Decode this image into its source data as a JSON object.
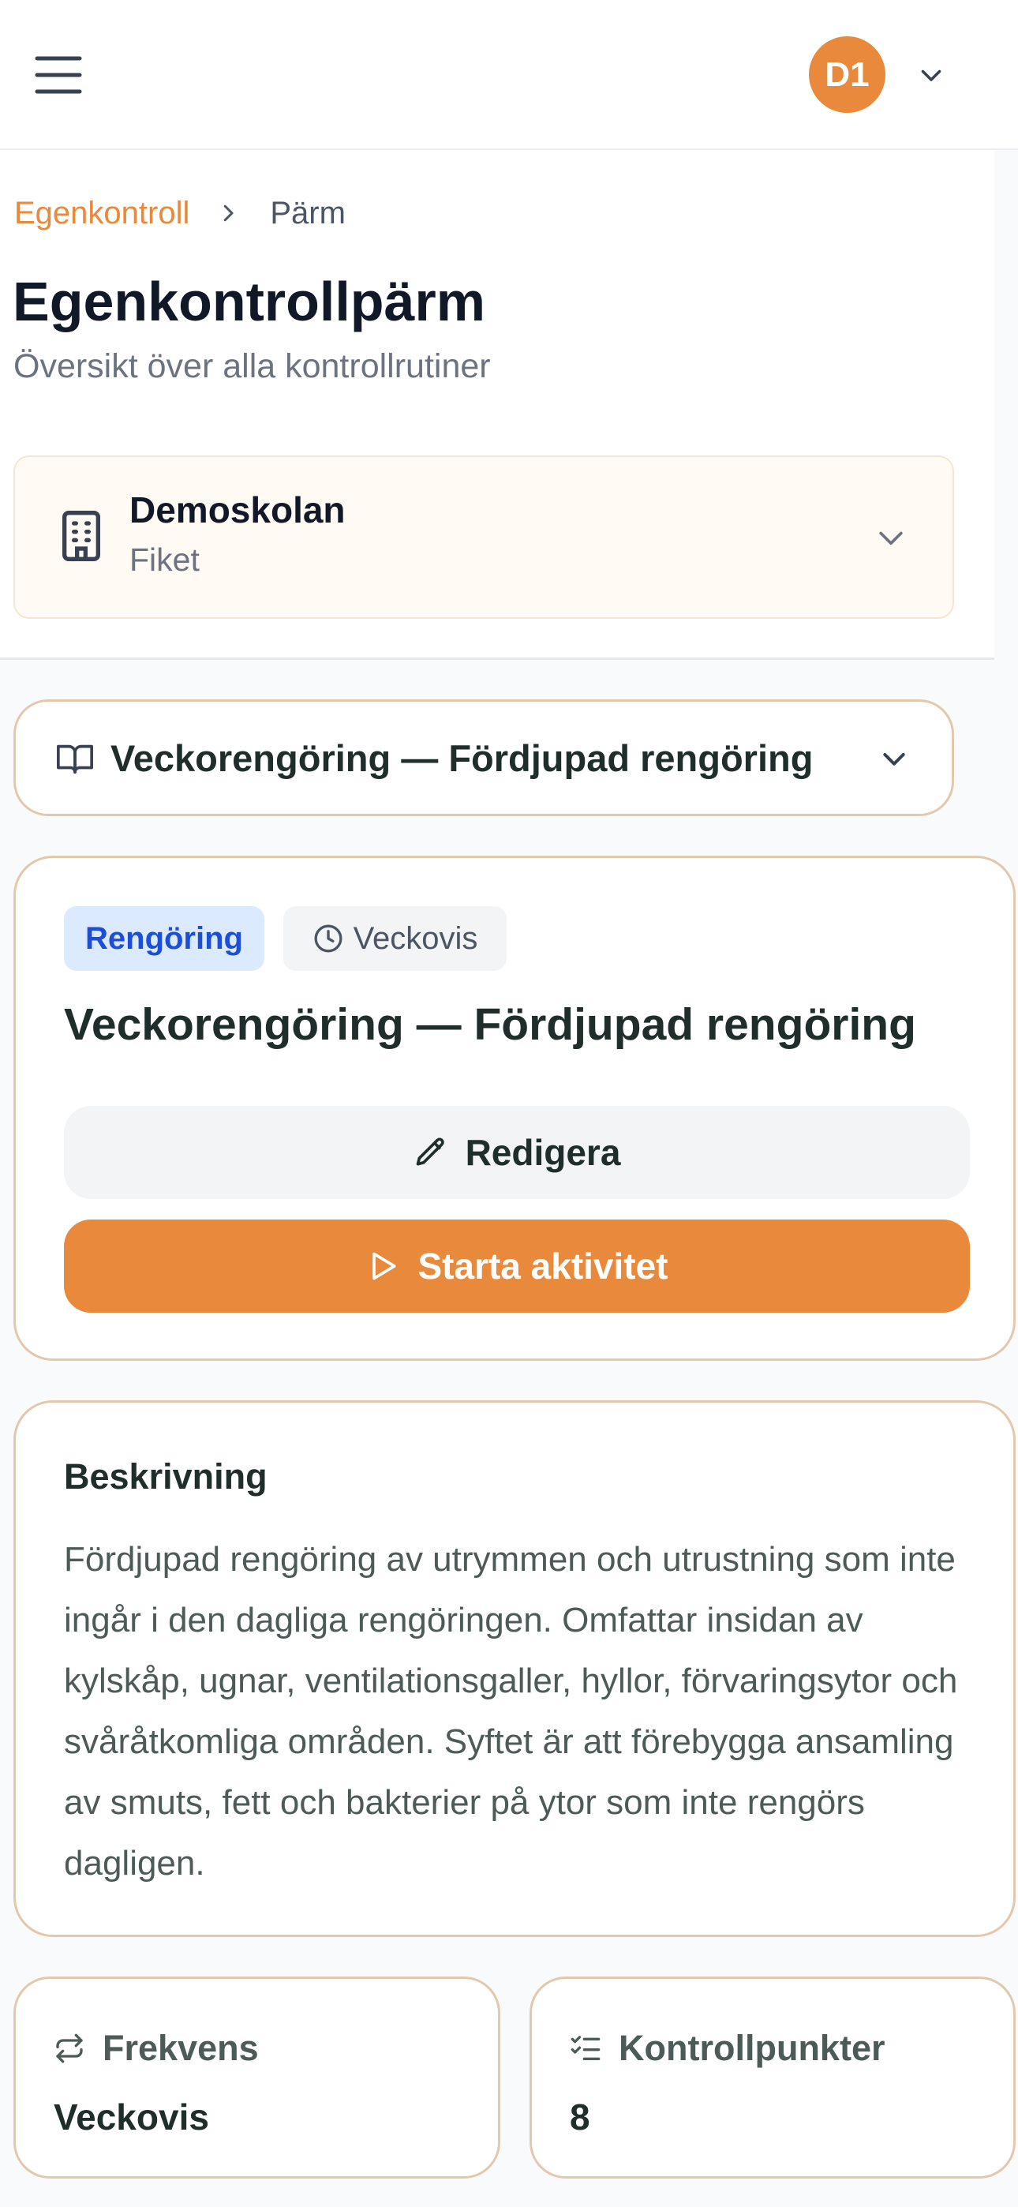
{
  "colors": {
    "accent": "#e8893b",
    "badge_category_bg": "#dbeafe",
    "badge_category_text": "#1d4ed8",
    "card_border": "#e2c9ad"
  },
  "topbar": {
    "menu_icon": "hamburger-menu-icon",
    "avatar_initials": "D1",
    "avatar_menu_icon": "chevron-down-icon"
  },
  "breadcrumb": {
    "parent": "Egenkontroll",
    "separator_icon": "chevron-right-icon",
    "current": "Pärm"
  },
  "page": {
    "title": "Egenkontrollpärm",
    "subtitle": "Översikt över alla kontrollrutiner"
  },
  "location": {
    "icon": "building-icon",
    "name": "Demoskolan",
    "unit": "Fiket",
    "dropdown_icon": "chevron-down-icon"
  },
  "routine_selector": {
    "icon": "book-open-icon",
    "selected": "Veckorengöring — Fördjupad rengöring",
    "dropdown_icon": "chevron-down-icon"
  },
  "routine": {
    "category": "Rengöring",
    "frequency_badge": "Veckovis",
    "title": "Veckorengöring — Fördjupad rengöring",
    "edit_label": "Redigera",
    "start_label": "Starta aktivitet"
  },
  "description": {
    "heading": "Beskrivning",
    "text": "Fördjupad rengöring av utrymmen och utrustning som inte ingår i den dagliga rengöringen. Omfattar insidan av kylskåp, ugnar, ventilationsgaller, hyllor, förvaringsytor och svåråtkomliga områden. Syftet är att förebygga ansamling av smuts, fett och bakterier på ytor som inte rengörs dagligen."
  },
  "stats": {
    "frequency": {
      "label": "Frekvens",
      "value": "Veckovis",
      "icon": "repeat-icon"
    },
    "checkpoints": {
      "label": "Kontrollpunkter",
      "value": "8",
      "icon": "list-checks-icon"
    }
  }
}
